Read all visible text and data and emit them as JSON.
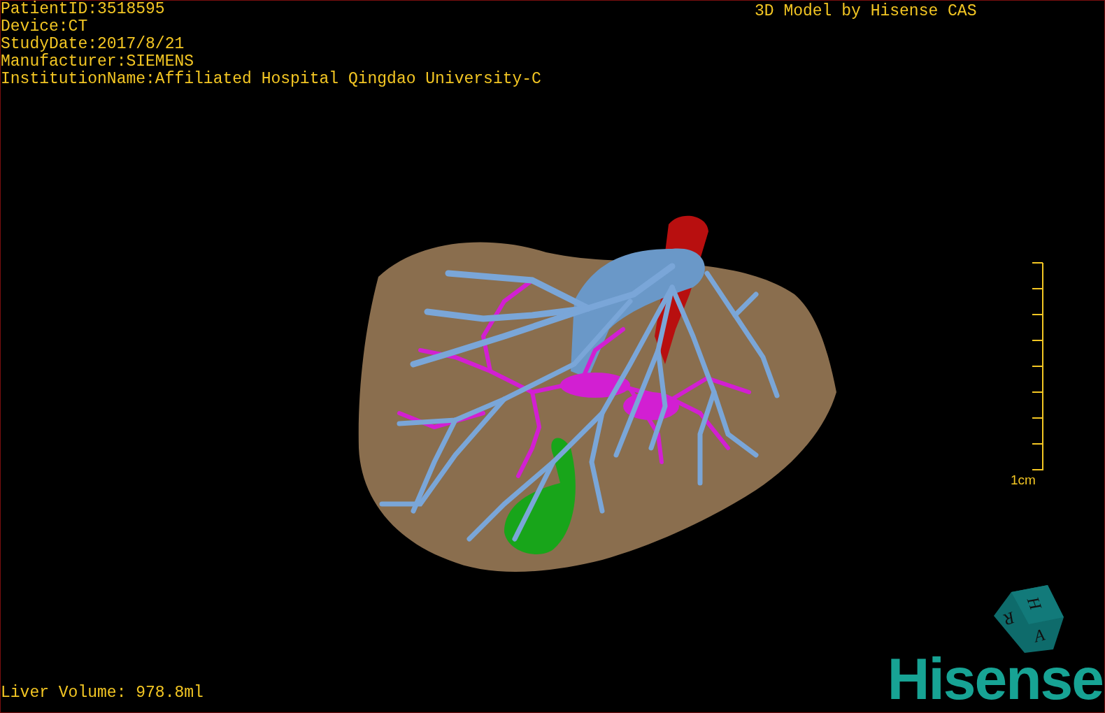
{
  "study_info": [
    "PatientID:3518595",
    "Device:CT",
    "StudyDate:2017/8/21",
    "Manufacturer:SIEMENS",
    "InstitutionName:Affiliated Hospital Qingdao University-C"
  ],
  "model_caption": "3D Model by Hisense CAS",
  "scale_bar": {
    "label": "1cm"
  },
  "orientation_cube": {
    "labels": [
      "H",
      "R",
      "A"
    ]
  },
  "liver_volume": "Liver Volume: 978.8ml",
  "logo": "Hisense"
}
